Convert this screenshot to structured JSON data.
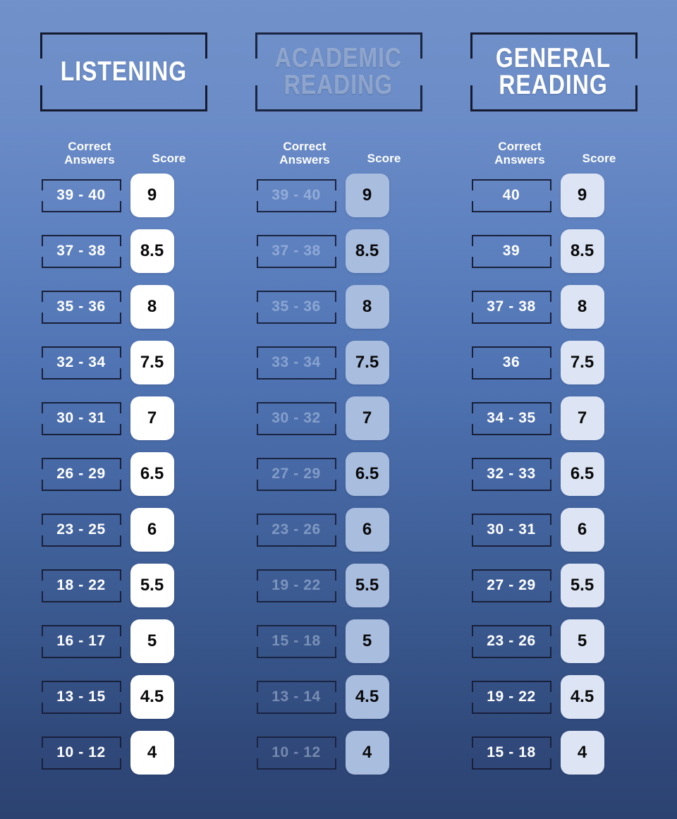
{
  "page": {
    "background_top": "#7191ca",
    "background_bottom": "#2c4371"
  },
  "columns": [
    {
      "id": "listening",
      "title": "LISTENING",
      "state": "active",
      "score_box_color": "#ffffff",
      "labels": {
        "answers": "Correct\nAnswers",
        "score": "Score"
      },
      "rows": [
        {
          "answers": "39 - 40",
          "score": "9"
        },
        {
          "answers": "37 - 38",
          "score": "8.5"
        },
        {
          "answers": "35 - 36",
          "score": "8"
        },
        {
          "answers": "32 - 34",
          "score": "7.5"
        },
        {
          "answers": "30 - 31",
          "score": "7"
        },
        {
          "answers": "26 - 29",
          "score": "6.5"
        },
        {
          "answers": "23 - 25",
          "score": "6"
        },
        {
          "answers": "18 - 22",
          "score": "5.5"
        },
        {
          "answers": "16 - 17",
          "score": "5"
        },
        {
          "answers": "13 - 15",
          "score": "4.5"
        },
        {
          "answers": "10 - 12",
          "score": "4"
        }
      ]
    },
    {
      "id": "academic-reading",
      "title": "ACADEMIC\nREADING",
      "state": "dimmed",
      "score_box_color": "#a9bddf",
      "labels": {
        "answers": "Correct\nAnswers",
        "score": "Score"
      },
      "rows": [
        {
          "answers": "39 - 40",
          "score": "9"
        },
        {
          "answers": "37 - 38",
          "score": "8.5"
        },
        {
          "answers": "35 - 36",
          "score": "8"
        },
        {
          "answers": "33 - 34",
          "score": "7.5"
        },
        {
          "answers": "30 - 32",
          "score": "7"
        },
        {
          "answers": "27 - 29",
          "score": "6.5"
        },
        {
          "answers": "23 - 26",
          "score": "6"
        },
        {
          "answers": "19 - 22",
          "score": "5.5"
        },
        {
          "answers": "15 - 18",
          "score": "5"
        },
        {
          "answers": "13 - 14",
          "score": "4.5"
        },
        {
          "answers": "10 - 12",
          "score": "4"
        }
      ]
    },
    {
      "id": "general-reading",
      "title": "GENERAL\nREADING",
      "state": "active",
      "score_box_color": "#dde5f4",
      "labels": {
        "answers": "Correct\nAnswers",
        "score": "Score"
      },
      "rows": [
        {
          "answers": "40",
          "score": "9"
        },
        {
          "answers": "39",
          "score": "8.5"
        },
        {
          "answers": "37 - 38",
          "score": "8"
        },
        {
          "answers": "36",
          "score": "7.5"
        },
        {
          "answers": "34 - 35",
          "score": "7"
        },
        {
          "answers": "32 - 33",
          "score": "6.5"
        },
        {
          "answers": "30 - 31",
          "score": "6"
        },
        {
          "answers": "27 - 29",
          "score": "5.5"
        },
        {
          "answers": "23 - 26",
          "score": "5"
        },
        {
          "answers": "19 - 22",
          "score": "4.5"
        },
        {
          "answers": "15 - 18",
          "score": "4"
        }
      ]
    }
  ]
}
